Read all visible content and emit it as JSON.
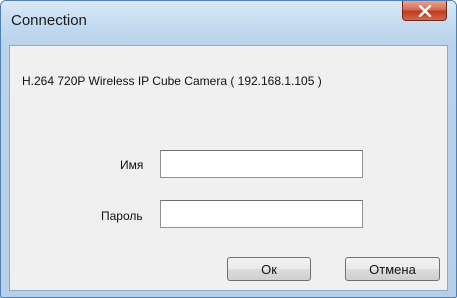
{
  "window": {
    "title": "Connection",
    "close_icon": "close-x-icon"
  },
  "dialog": {
    "device_label": "H.264 720P Wireless IP Cube Camera ( 192.168.1.105 )",
    "username_label": "Имя",
    "username_value": "",
    "password_label": "Пароль",
    "password_value": "",
    "ok_label": "Ок",
    "cancel_label": "Отмена"
  },
  "colors": {
    "titlebar": "#c6dbf1",
    "close_button": "#c1391f",
    "client_area": "#f0f0f0"
  }
}
